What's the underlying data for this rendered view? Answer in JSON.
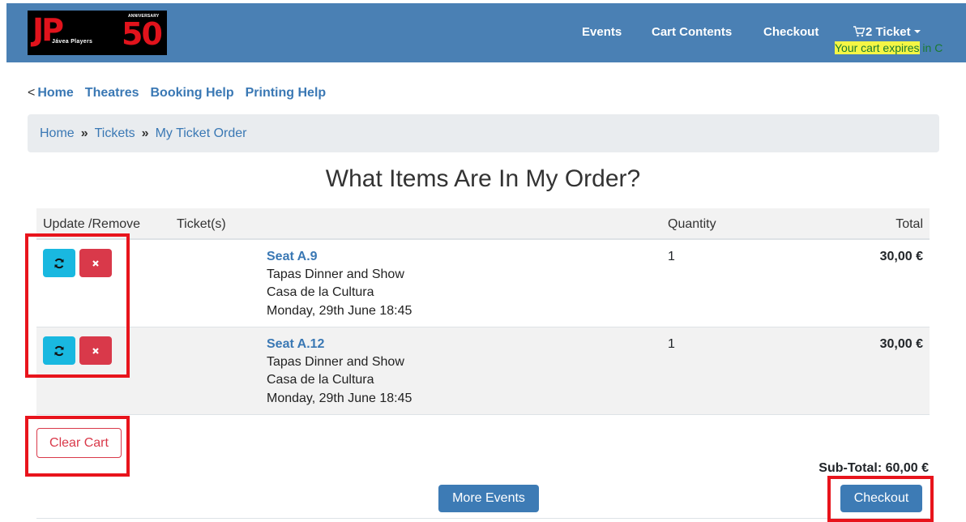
{
  "navbar": {
    "logo": {
      "jp": "JP",
      "name": "Jávea Players",
      "anniversary": "ANNIVERSARY",
      "number": "50"
    },
    "links": [
      "Events",
      "Cart Contents",
      "Checkout"
    ],
    "cart_label": "2 Ticket",
    "expires_text": "Your cart expires",
    "expires_tail": " in C"
  },
  "sublinks": {
    "prefix": "<",
    "items": [
      "Home",
      "Theatres",
      "Booking Help",
      "Printing Help"
    ]
  },
  "breadcrumb": {
    "items": [
      "Home",
      "Tickets",
      "My Ticket Order"
    ],
    "separator": "»"
  },
  "page_title": "What Items Are In My Order?",
  "table": {
    "headers": {
      "update": "Update /Remove",
      "tickets": "Ticket(s)",
      "quantity": "Quantity",
      "total": "Total"
    },
    "rows": [
      {
        "seat": "Seat A.9",
        "event": "Tapas Dinner and Show",
        "venue": "Casa de la Cultura",
        "date": "Monday, 29th June 18:45",
        "quantity": "1",
        "total": "30,00 €"
      },
      {
        "seat": "Seat A.12",
        "event": "Tapas Dinner and Show",
        "venue": "Casa de la Cultura",
        "date": "Monday, 29th June 18:45",
        "quantity": "1",
        "total": "30,00 €"
      }
    ]
  },
  "clear_cart_label": "Clear Cart",
  "subtotal": "Sub-Total: 60,00 €",
  "more_events_label": "More Events",
  "checkout_label": "Checkout",
  "colors": {
    "navbar": "#4a80b4",
    "link": "#3a78b4",
    "update": "#19b8e0",
    "remove": "#d9394a",
    "primary": "#3d7bb5",
    "annotation": "#e8141c"
  }
}
